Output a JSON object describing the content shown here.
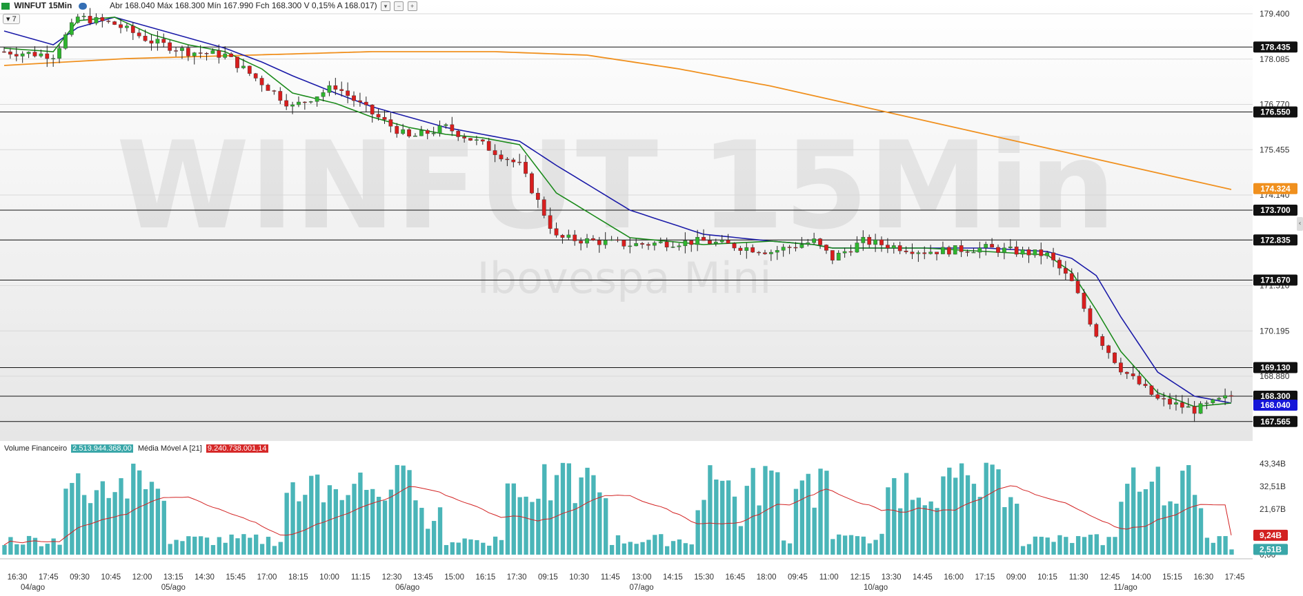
{
  "header": {
    "symbol": "WINFUT 15Min",
    "ohlc": "Abr 168.040 Máx 168.300 Mín 167.990 Fch 168.300 V 0,15% A 168.017)",
    "indicator_count": "7"
  },
  "watermark": {
    "big": "WINFUT 15Min",
    "small": "Ibovespa Mini"
  },
  "volume_header": {
    "label": "Volume Financeiro",
    "value": "2.513.944.368,00",
    "ma_label": "Média Móvel A [21]",
    "ma_value": "9.240.738.001,14"
  },
  "colors": {
    "up": "#2fb52f",
    "down": "#d81e1e",
    "ema_fast": "#1a8a1a",
    "ema_slow": "#1a1aa8",
    "sma_long": "#f0901e",
    "volume": "#4ab5b8",
    "vol_ma": "#d22020"
  },
  "chart_data": {
    "type": "candlestick",
    "title": "WINFUT 15Min",
    "y_axis_ticks": [
      "179.400",
      "178.085",
      "176.770",
      "175.455",
      "174.140",
      "172.825",
      "171.510",
      "170.195",
      "168.880",
      "167.565"
    ],
    "ylim": [
      167.1,
      179.6
    ],
    "price_levels": [
      "178.435",
      "176.550",
      "173.700",
      "172.835",
      "171.670",
      "169.130",
      "168.300",
      "167.565"
    ],
    "current_price": "168.040",
    "ma_long_value": "174.324",
    "x_time_labels": [
      "16:30",
      "17:45",
      "09:30",
      "10:45",
      "12:00",
      "13:15",
      "14:30",
      "15:45",
      "17:00",
      "18:15",
      "10:00",
      "11:15",
      "12:30",
      "13:45",
      "15:00",
      "16:15",
      "17:30",
      "09:15",
      "10:30",
      "11:45",
      "13:00",
      "14:15",
      "15:30",
      "16:45",
      "18:00",
      "09:45",
      "11:00",
      "12:15",
      "13:30",
      "14:45",
      "16:00",
      "17:15",
      "09:00",
      "10:15",
      "11:30",
      "12:45",
      "14:00",
      "15:15",
      "16:30",
      "17:45"
    ],
    "x_date_labels": [
      "04/ago",
      "05/ago",
      "06/ago",
      "07/ago",
      "10/ago",
      "11/ago"
    ],
    "close_path": [
      [
        0,
        178.3
      ],
      [
        8,
        178.2
      ],
      [
        12,
        179.3
      ],
      [
        18,
        179.1
      ],
      [
        24,
        178.6
      ],
      [
        30,
        178.3
      ],
      [
        36,
        178.2
      ],
      [
        42,
        177.4
      ],
      [
        47,
        176.7
      ],
      [
        54,
        177.3
      ],
      [
        60,
        176.5
      ],
      [
        66,
        175.8
      ],
      [
        72,
        176.1
      ],
      [
        78,
        175.6
      ],
      [
        84,
        175.0
      ],
      [
        90,
        172.9
      ],
      [
        102,
        172.7
      ],
      [
        114,
        172.8
      ],
      [
        125,
        172.5
      ],
      [
        132,
        172.8
      ],
      [
        135,
        172.3
      ],
      [
        140,
        172.8
      ],
      [
        150,
        172.5
      ],
      [
        160,
        172.6
      ],
      [
        170,
        172.4
      ],
      [
        174,
        171.6
      ],
      [
        178,
        170.1
      ],
      [
        182,
        169.1
      ],
      [
        188,
        168.2
      ],
      [
        194,
        167.9
      ],
      [
        200,
        168.3
      ]
    ],
    "ema_fast_path": [
      [
        0,
        178.4
      ],
      [
        8,
        178.3
      ],
      [
        12,
        179.2
      ],
      [
        18,
        179.3
      ],
      [
        24,
        178.8
      ],
      [
        30,
        178.5
      ],
      [
        36,
        178.3
      ],
      [
        42,
        177.8
      ],
      [
        47,
        177.1
      ],
      [
        54,
        176.8
      ],
      [
        60,
        176.4
      ],
      [
        66,
        176.1
      ],
      [
        72,
        175.9
      ],
      [
        78,
        175.8
      ],
      [
        84,
        175.6
      ],
      [
        90,
        174.2
      ],
      [
        102,
        172.9
      ],
      [
        114,
        172.7
      ],
      [
        125,
        172.8
      ],
      [
        132,
        172.7
      ],
      [
        135,
        172.6
      ],
      [
        140,
        172.6
      ],
      [
        150,
        172.6
      ],
      [
        160,
        172.5
      ],
      [
        170,
        172.4
      ],
      [
        174,
        171.9
      ],
      [
        178,
        170.8
      ],
      [
        182,
        169.6
      ],
      [
        188,
        168.4
      ],
      [
        194,
        168.0
      ],
      [
        200,
        168.1
      ]
    ],
    "ema_slow_path": [
      [
        0,
        178.9
      ],
      [
        8,
        178.5
      ],
      [
        12,
        179.0
      ],
      [
        18,
        179.3
      ],
      [
        24,
        179.0
      ],
      [
        30,
        178.7
      ],
      [
        36,
        178.4
      ],
      [
        42,
        178.0
      ],
      [
        47,
        177.6
      ],
      [
        54,
        177.1
      ],
      [
        60,
        176.7
      ],
      [
        66,
        176.4
      ],
      [
        72,
        176.1
      ],
      [
        78,
        175.9
      ],
      [
        84,
        175.7
      ],
      [
        90,
        175.0
      ],
      [
        102,
        173.7
      ],
      [
        114,
        173.0
      ],
      [
        125,
        172.8
      ],
      [
        132,
        172.7
      ],
      [
        135,
        172.6
      ],
      [
        140,
        172.6
      ],
      [
        150,
        172.6
      ],
      [
        160,
        172.6
      ],
      [
        170,
        172.5
      ],
      [
        174,
        172.3
      ],
      [
        178,
        171.8
      ],
      [
        182,
        170.6
      ],
      [
        188,
        169.0
      ],
      [
        194,
        168.3
      ],
      [
        200,
        168.1
      ]
    ],
    "sma_long_path": [
      [
        0,
        177.9
      ],
      [
        20,
        178.1
      ],
      [
        40,
        178.2
      ],
      [
        60,
        178.3
      ],
      [
        80,
        178.3
      ],
      [
        95,
        178.2
      ],
      [
        110,
        177.8
      ],
      [
        125,
        177.3
      ],
      [
        140,
        176.7
      ],
      [
        155,
        176.1
      ],
      [
        170,
        175.5
      ],
      [
        185,
        174.9
      ],
      [
        200,
        174.3
      ]
    ],
    "volume_axis_ticks": [
      "43,34B",
      "32,51B",
      "21,67B",
      "0,00"
    ],
    "volume_ma_value": "9,24B",
    "volume_value": "2,51B"
  }
}
